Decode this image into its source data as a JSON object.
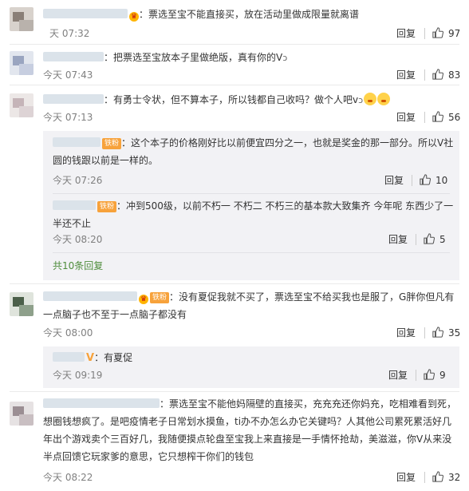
{
  "comments": [
    {
      "text": "：票选至宝不能直接买，放在活动里做成限量就离谱",
      "time": "天 07:32",
      "reply_label": "回复",
      "likes": "97"
    },
    {
      "text": "：把票选至宝放本子里做绝版，真有你的V",
      "time": "今天 07:43",
      "reply_label": "回复",
      "likes": "83"
    },
    {
      "text": "：有勇士令状，但不算本子，所以钱都自己收吗？做个人吧v",
      "time": "今天 07:13",
      "reply_label": "回复",
      "likes": "56",
      "replies": [
        {
          "badge": "铁粉",
          "line1": "：这个本子的价格刚好比以前便宜四分之一，也就是奖金的那一部分。所以V社",
          "line2": "圆的钱跟以前是一样的。",
          "time": "今天 07:26",
          "reply_label": "回复",
          "likes": "10"
        },
        {
          "badge": "铁粉",
          "line1": "：冲到500级，以前不朽一 不朽二 不朽三的基本款大致集齐   今年呢 东西少了一",
          "line2": "半还不止",
          "time": "今天 08:20",
          "reply_label": "回复",
          "likes": "5"
        }
      ],
      "more_label": "共10条回复"
    },
    {
      "badge": "铁粉",
      "line1": "：没有夏促我就不买了，票选至宝不给买我也是服了，G胖你但凡有",
      "line2": "一点脑子也不至于一点脑子都没有",
      "time": "今天 08:00",
      "reply_label": "回复",
      "likes": "35",
      "replies": [
        {
          "mark": "V",
          "line1": "：有夏促",
          "time": "今天 09:19",
          "reply_label": "回复",
          "likes": "9"
        }
      ]
    },
    {
      "line1": "：票选至宝不能他妈隔壁的直接买，充充充还你妈充，吃相难看到死，",
      "line2": "想圈钱想疯了。是吧疫情老子日常划水摸鱼，ti办不办怎么办它关键吗？人其他公司累死累活好几",
      "line3": "年出个游戏卖个三百好几，我随便摸点轮盘至宝我上来直接是一手情怀抢劫，美滋滋，你V从来没",
      "line4": "半点回馈它玩家爹的意思，它只想榨干你们的钱包",
      "time": "今天 08:22",
      "reply_label": "回复",
      "likes": "32"
    }
  ],
  "colors": {
    "link_green": "#4f8d3c",
    "badge_orange": "#f7a23b",
    "meta_gray": "#808080"
  },
  "icons": [
    "thumb-up-icon",
    "crown-icon",
    "v-verified-icon",
    "emoji-icon"
  ]
}
